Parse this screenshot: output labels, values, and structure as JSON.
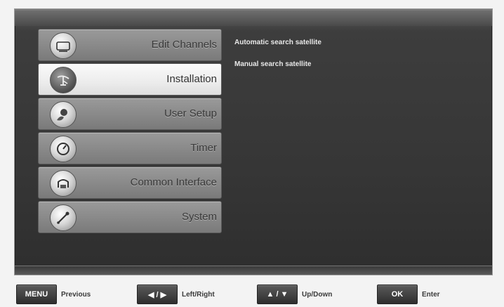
{
  "menu": {
    "items": [
      {
        "label": "Edit Channels",
        "icon": "tv-icon"
      },
      {
        "label": "Installation",
        "icon": "satellite-dish-icon"
      },
      {
        "label": "User Setup",
        "icon": "user-setup-icon"
      },
      {
        "label": "Timer",
        "icon": "timer-icon"
      },
      {
        "label": "Common Interface",
        "icon": "common-interface-icon"
      },
      {
        "label": "System",
        "icon": "system-icon"
      }
    ],
    "selected_index": 1
  },
  "submenu": {
    "items": [
      {
        "label": "Automatic search satellite"
      },
      {
        "label": "Manual search satellite"
      }
    ]
  },
  "footer": {
    "keys": [
      {
        "button": "MENU",
        "label": "Previous"
      },
      {
        "button": "◀ / ▶",
        "label": "Left/Right"
      },
      {
        "button": "▲ / ▼",
        "label": "Up/Down"
      },
      {
        "button": "OK",
        "label": "Enter"
      }
    ]
  }
}
